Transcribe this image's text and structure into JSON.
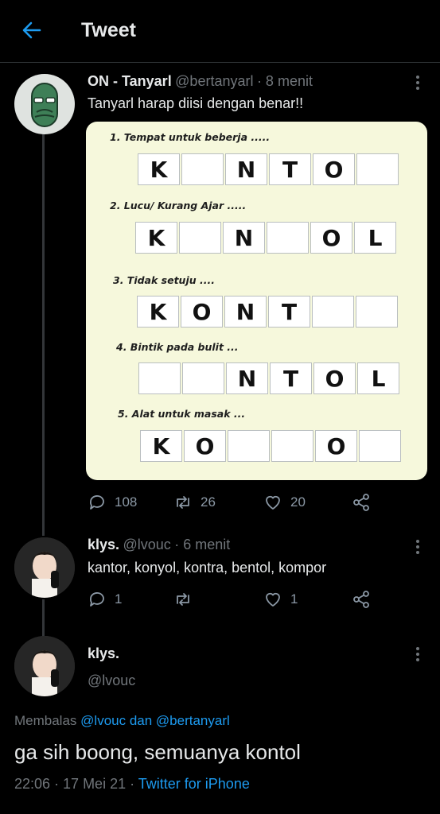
{
  "header": {
    "title": "Tweet"
  },
  "tweet": {
    "name": "ON - Tanyarl",
    "handle": "@bertanyarl",
    "time": "· 8 menit",
    "text": "Tanyarl harap diisi dengan benar!!",
    "puzzle": [
      {
        "question": "1. Tempat untuk beberja .....",
        "cells": [
          "K",
          "",
          "N",
          "T",
          "O",
          ""
        ]
      },
      {
        "question": "2. Lucu/ Kurang Ajar .....",
        "cells": [
          "K",
          "",
          "N",
          "",
          "O",
          "L"
        ]
      },
      {
        "question": "3. Tidak setuju ....",
        "cells": [
          "K",
          "O",
          "N",
          "T",
          "",
          ""
        ]
      },
      {
        "question": "4. Bintik pada bulit ...",
        "cells": [
          "",
          "",
          "N",
          "T",
          "O",
          "L"
        ]
      },
      {
        "question": "5. Alat untuk masak ...",
        "cells": [
          "K",
          "O",
          "",
          "",
          "O",
          ""
        ]
      }
    ],
    "stats": {
      "replies": "108",
      "retweets": "26",
      "likes": "20"
    }
  },
  "reply1": {
    "name": "klys.",
    "handle": "@lvouc",
    "time": "· 6 menit",
    "text": "kantor, konyol, kontra, bentol, kompor",
    "stats": {
      "replies": "1",
      "retweets": "",
      "likes": "1"
    }
  },
  "main_reply": {
    "name": "klys.",
    "handle": "@lvouc",
    "replying_prefix": "Membalas",
    "replying_to": "@lvouc dan @bertanyarl",
    "text": "ga sih boong, semuanya kontol",
    "timestamp": "22:06 · 17 Mei 21 ·",
    "source": "Twitter for iPhone"
  },
  "colors": {
    "accent": "#1d9bf0",
    "background": "#000000",
    "muted": "#71767b"
  }
}
